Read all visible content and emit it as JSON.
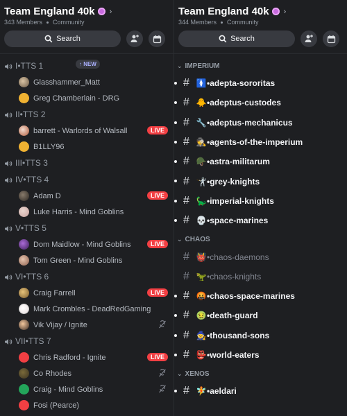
{
  "left": {
    "server": {
      "name": "Team England 40k",
      "members": "343 Members",
      "type": "Community"
    },
    "search_label": "Search",
    "voice_channels": [
      {
        "name": "I•TTS 1",
        "new_badge": "NEW",
        "users": [
          {
            "name": "Glasshammer_Matt",
            "avatar": "av-photo1"
          },
          {
            "name": "Greg Chamberlain - DRG",
            "avatar": "av-discord-orange"
          }
        ]
      },
      {
        "name": "II•TTS 2",
        "users": [
          {
            "name": "barrett - Warlords of Walsall",
            "avatar": "av-photo2",
            "live": "LIVE"
          },
          {
            "name": "B1LLY96",
            "avatar": "av-discord-orange"
          }
        ]
      },
      {
        "name": "III•TTS 3",
        "users": []
      },
      {
        "name": "IV•TTS 4",
        "users": [
          {
            "name": "Adam D",
            "avatar": "av-photo3",
            "live": "LIVE"
          },
          {
            "name": "Luke Harris - Mind Goblins",
            "avatar": "av-photo4"
          }
        ]
      },
      {
        "name": "V•TTS 5",
        "users": [
          {
            "name": "Dom Maidlow - Mind Goblins",
            "avatar": "av-photo5",
            "live": "LIVE"
          },
          {
            "name": "Tom Green - Mind Goblins",
            "avatar": "av-photo6"
          }
        ]
      },
      {
        "name": "VI•TTS 6",
        "users": [
          {
            "name": "Craig Farrell",
            "avatar": "av-photo7",
            "live": "LIVE"
          },
          {
            "name": "Mark Crombles - DeadRedGaming",
            "avatar": "av-photo8"
          },
          {
            "name": "Vik Vijay / Ignite",
            "avatar": "av-photo9",
            "muted": true
          }
        ]
      },
      {
        "name": "VII•TTS 7",
        "users": [
          {
            "name": "Chris Radford - Ignite",
            "avatar": "av-discord-red",
            "live": "LIVE"
          },
          {
            "name": "Co Rhodes",
            "avatar": "av-photo10",
            "muted": true
          },
          {
            "name": "Craig - Mind Goblins",
            "avatar": "av-discord-green",
            "muted": true
          },
          {
            "name": "Fosi (Pearce)",
            "avatar": "av-discord-red"
          }
        ]
      }
    ]
  },
  "right": {
    "server": {
      "name": "Team England 40k",
      "members": "344 Members",
      "type": "Community"
    },
    "search_label": "Search",
    "categories": [
      {
        "name": "IMPERIUM",
        "channels": [
          {
            "emoji": "🚺",
            "name": "adepta-sororitas",
            "unread": true
          },
          {
            "emoji": "🐥",
            "name": "adeptus-custodes",
            "unread": true
          },
          {
            "emoji": "🔧",
            "name": "adeptus-mechanicus",
            "unread": true
          },
          {
            "emoji": "🕵",
            "name": "agents-of-the-imperium",
            "unread": true
          },
          {
            "emoji": "🪖",
            "name": "astra-militarum",
            "unread": true
          },
          {
            "emoji": "🤺",
            "name": "grey-knights",
            "unread": true
          },
          {
            "emoji": "🦕",
            "name": "imperial-knights",
            "unread": true
          },
          {
            "emoji": "💀",
            "name": "space-marines",
            "unread": true
          }
        ]
      },
      {
        "name": "CHAOS",
        "channels": [
          {
            "emoji": "👹",
            "name": "chaos-daemons",
            "unread": false
          },
          {
            "emoji": "🦖",
            "name": "chaos-knights",
            "unread": false
          },
          {
            "emoji": "🤬",
            "name": "chaos-space-marines",
            "unread": true
          },
          {
            "emoji": "🤢",
            "name": "death-guard",
            "unread": true
          },
          {
            "emoji": "🧙",
            "name": "thousand-sons",
            "unread": true
          },
          {
            "emoji": "👺",
            "name": "world-eaters",
            "unread": true
          }
        ]
      },
      {
        "name": "XENOS",
        "channels": [
          {
            "emoji": "🧚",
            "name": "aeldari",
            "unread": true
          }
        ]
      }
    ]
  },
  "colors": {
    "live": "#f23f43",
    "boost": "#c86adf",
    "background": "#1e1f22"
  }
}
